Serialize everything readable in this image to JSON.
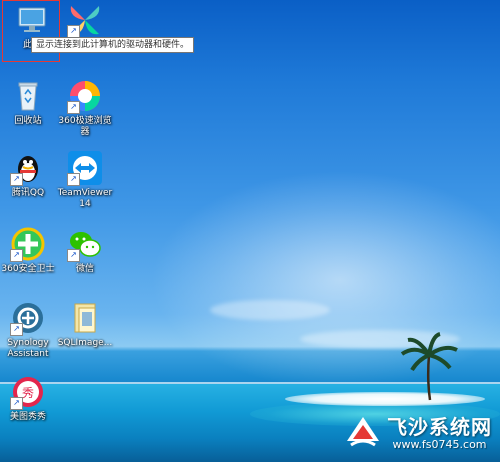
{
  "desktop": {
    "icons": [
      {
        "label": "此电"
      },
      {
        "label": ""
      },
      {
        "label": "回收站"
      },
      {
        "label": "360极速浏览\n器"
      },
      {
        "label": "腾讯QQ"
      },
      {
        "label": "TeamViewer\n14"
      },
      {
        "label": "360安全卫士"
      },
      {
        "label": "微信"
      },
      {
        "label": "Synology\nAssistant"
      },
      {
        "label": "SQLImage..."
      },
      {
        "label": "美图秀秀"
      }
    ],
    "tooltip": "显示连接到此计算机的驱动器和硬件。"
  },
  "watermark": {
    "title": "飞沙系统网",
    "url": "www.fs0745.com"
  },
  "colors": {
    "selection": "#e53935",
    "sky": "#1f7ad8",
    "sea": "#119ad5"
  }
}
